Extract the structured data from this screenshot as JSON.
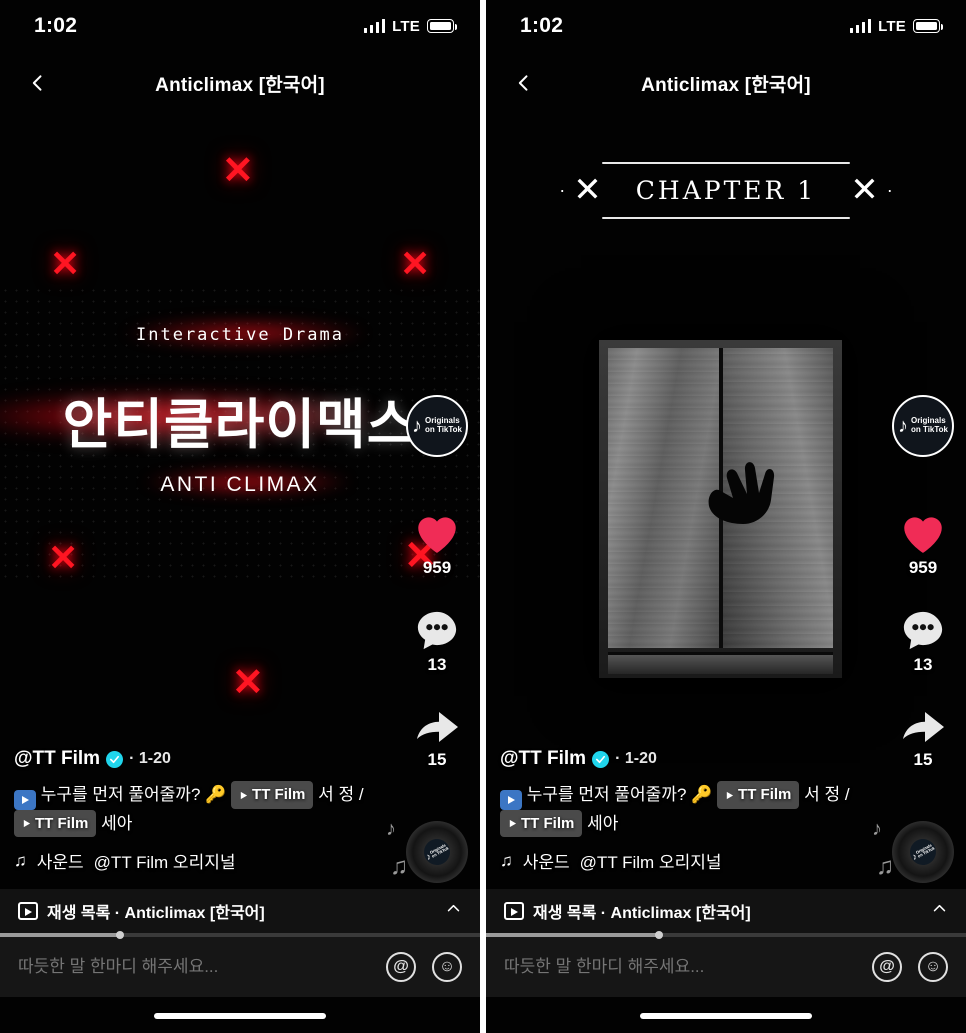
{
  "status": {
    "time": "1:02",
    "network": "LTE",
    "signal_icon": "signal-bars-icon",
    "battery_icon": "battery-icon"
  },
  "nav": {
    "back_icon": "back-chevron-icon",
    "title": "Anticlimax [한국어]"
  },
  "left_panel": {
    "poster": {
      "tagline": "Interactive Drama",
      "title_korean": "안티클라이맥스",
      "subtitle": "ANTI CLIMAX"
    }
  },
  "right_panel": {
    "chapter": {
      "label": "CHAPTER 1",
      "left_dot": "·",
      "left_x": "✕",
      "right_x": "✕",
      "right_dot": "·"
    },
    "scene": {
      "description_icon": "wardrobe-with-hand-icon"
    }
  },
  "originals_badge": {
    "note_icon": "tiktok-note-icon",
    "line1": "Originals",
    "line2": "on TikTok"
  },
  "actions": {
    "like": {
      "icon": "heart-icon",
      "count": "959",
      "color": "#f02c56"
    },
    "comment": {
      "icon": "comment-bubble-icon",
      "count": "13"
    },
    "share": {
      "icon": "share-arrow-icon",
      "count": "15"
    }
  },
  "caption": {
    "username": "@TT Film",
    "verified_icon": "verified-check-icon",
    "date": "· 1-20",
    "play_icon": "play-icon",
    "line1_text": "누구를 먼저 풀어줄까?",
    "key_emoji": "🔑",
    "chip1": "TT Film",
    "text_after_chip1": "서",
    "line2_prefix": "정 /",
    "chip2": "TT Film",
    "text_after_chip2": "세아",
    "music_icon": "music-note-icon",
    "music_label": "사운드",
    "music_author": "@TT Film 오리지널"
  },
  "disc": {
    "note_icon": "tiktok-note-icon",
    "line1": "Originals",
    "line2": "on TikTok"
  },
  "playlist": {
    "icon": "playlist-icon",
    "label": "재생 목록 · Anticlimax [한국어]",
    "chevron_icon": "chevron-up-icon",
    "progress_left_pct": 25,
    "progress_right_pct": 36
  },
  "comment_bar": {
    "placeholder": "따듯한 말 한마디 해주세요...",
    "mention_icon": "at-mention-icon",
    "mention_glyph": "@",
    "emoji_icon": "smiley-emoji-icon",
    "emoji_glyph": "☺"
  },
  "colors": {
    "red_x": "#ff1522",
    "accent_like": "#f02c56",
    "verified_blue": "#20d5ec"
  }
}
